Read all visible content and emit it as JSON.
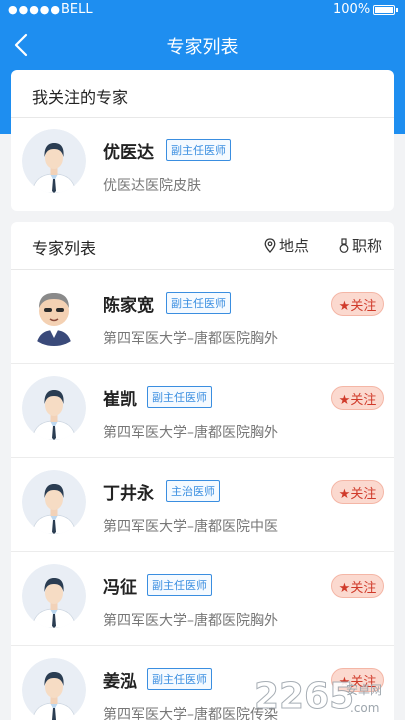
{
  "status_bar": {
    "signal": "●●●●●",
    "carrier": "BELL",
    "battery": "100%"
  },
  "nav": {
    "title": "专家列表"
  },
  "followed_section": {
    "title": "我关注的专家",
    "doctor": {
      "name": "优医达",
      "title": "副主任医师",
      "hospital": "优医达医院皮肤"
    }
  },
  "list_section": {
    "title": "专家列表",
    "filters": [
      {
        "label": "地点",
        "icon": "location-pin-icon"
      },
      {
        "label": "职称",
        "icon": "badge-icon"
      }
    ],
    "doctors": [
      {
        "name": "陈家宽",
        "title": "副主任医师",
        "hospital": "第四军医大学–唐都医院胸外",
        "follow": "★关注",
        "avatar": "cartoon-doctor"
      },
      {
        "name": "崔凯",
        "title": "副主任医师",
        "hospital": "第四军医大学–唐都医院胸外",
        "follow": "★关注",
        "avatar": "doctor-avatar"
      },
      {
        "name": "丁井永",
        "title": "主治医师",
        "hospital": "第四军医大学–唐都医院中医",
        "follow": "★关注",
        "avatar": "doctor-avatar"
      },
      {
        "name": "冯征",
        "title": "副主任医师",
        "hospital": "第四军医大学–唐都医院胸外",
        "follow": "★关注",
        "avatar": "doctor-avatar"
      },
      {
        "name": "姜泓",
        "title": "副主任医师",
        "hospital": "第四军医大学–唐都医院传染",
        "follow": "★关注",
        "avatar": "doctor-avatar"
      }
    ]
  },
  "watermark": {
    "text": "2265",
    "sub": "安卓网",
    "domain": ".com"
  }
}
